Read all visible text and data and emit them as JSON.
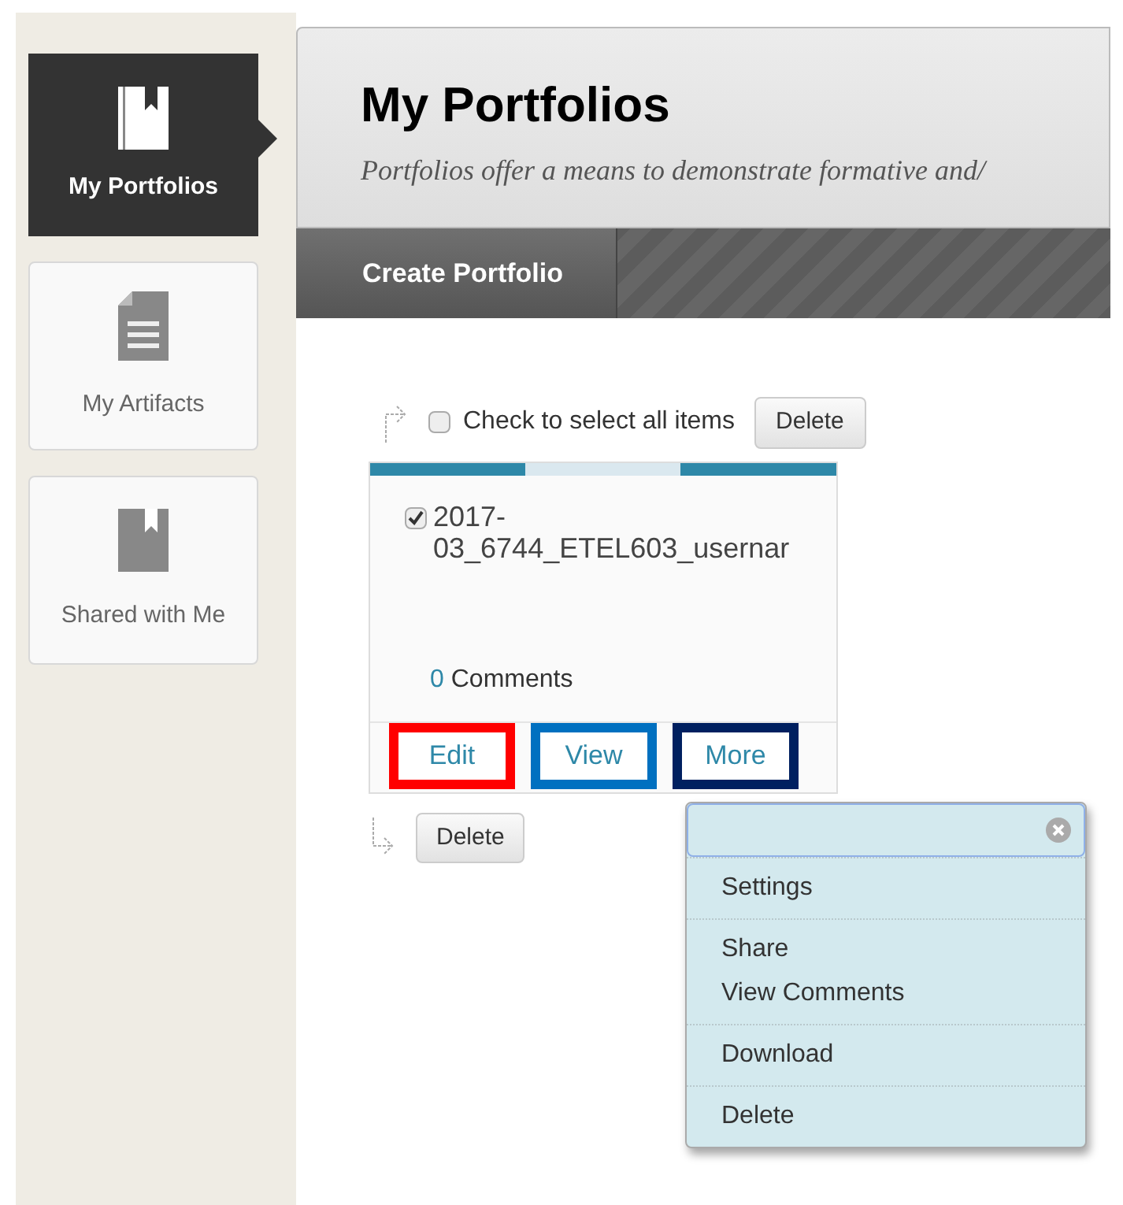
{
  "sidebar": {
    "items": [
      {
        "label": "My Portfolios",
        "kind": "book",
        "selected": true
      },
      {
        "label": "My Artifacts",
        "kind": "document",
        "selected": false
      },
      {
        "label": "Shared with Me",
        "kind": "book",
        "selected": false
      }
    ]
  },
  "header": {
    "title": "My Portfolios",
    "subtitle": "Portfolios offer a means to demonstrate formative and/"
  },
  "toolbar": {
    "button": "Create Portfolio"
  },
  "select_all": {
    "label": "Check to select all items",
    "checked": false,
    "button": "Delete"
  },
  "portfolio": {
    "name": "2017-03_6744_ETEL603_usernar",
    "checked": true,
    "comment_count": "0",
    "comments_label": "Comments",
    "actions": [
      {
        "label": "Edit",
        "color": "#ff0000"
      },
      {
        "label": "View",
        "color": "#0070c0"
      },
      {
        "label": "More",
        "color": "#002060"
      }
    ]
  },
  "bottom_button": "Delete",
  "menu": {
    "groups": [
      [
        "Settings"
      ],
      [
        "Share",
        "View Comments"
      ],
      [
        "Download"
      ],
      [
        "Delete"
      ]
    ]
  }
}
